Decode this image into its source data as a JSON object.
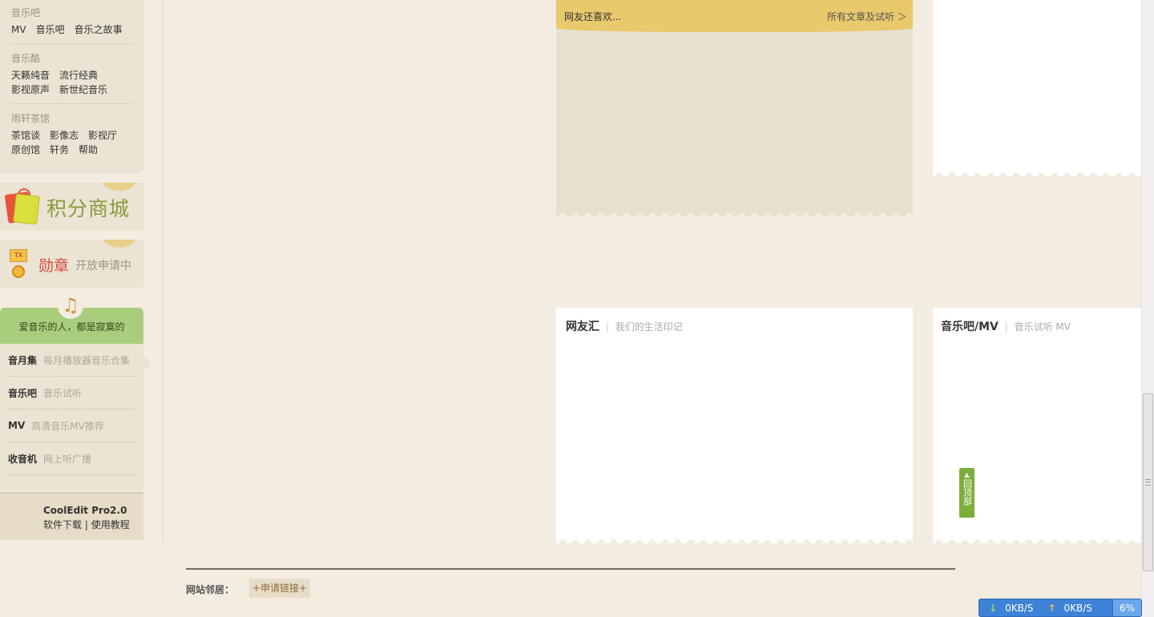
{
  "nav": {
    "groups": [
      {
        "head": "音乐吧",
        "lines": [
          [
            "MV",
            "音乐吧",
            "音乐之故事"
          ]
        ]
      },
      {
        "head": "音乐酷",
        "lines": [
          [
            "天籁纯音",
            "流行经典"
          ],
          [
            "影视原声",
            "新世纪音乐"
          ]
        ]
      },
      {
        "head": "雨轩茶馆",
        "lines": [
          [
            "茶馆谈",
            "影像志",
            "影视厅"
          ],
          [
            "原创馆",
            "轩务",
            "帮助"
          ]
        ]
      }
    ]
  },
  "promos": {
    "shop": "积分商城",
    "medal": "勋章",
    "medal_sub": "开放申请中",
    "medal_icon_text": "TX"
  },
  "music": {
    "slogan": "爱音乐的人，都是寂寞的",
    "note": "♫",
    "items": [
      {
        "title": "音月集",
        "desc": "每月播放器音乐合集"
      },
      {
        "title": "音乐吧",
        "desc": "音乐试听"
      },
      {
        "title": "MV",
        "desc": "高清音乐MV推荐"
      },
      {
        "title": "收音机",
        "desc": "网上听广播"
      }
    ],
    "cooledit_title": "CoolEdit Pro2.0",
    "cooledit_download": "软件下载",
    "cooledit_sep": "|",
    "cooledit_tutorial": "使用教程"
  },
  "cards": {
    "yellow_left": "网友还喜欢...",
    "yellow_right": "所有文章及试听 ＞",
    "netfriend_title": "网友汇",
    "netfriend_sub": "我们的生活印记",
    "musicbar_title": "音乐吧/MV",
    "musicbar_sub": "音乐试听 MV",
    "sep": "|"
  },
  "back_top": {
    "arrow": "▲",
    "label": "回顶部"
  },
  "footer": {
    "label": "网站邻居：",
    "apply_link": "+申请链接+"
  },
  "speed": {
    "down_arrow": "↓",
    "down": "0KB/S",
    "up_arrow": "↑",
    "up": "0KB/S",
    "percent": "6%"
  },
  "colors": {
    "page_bg": "#f3ece0",
    "panel_bg": "#ebe3d3",
    "yellow_header": "#e8c96c",
    "music_green": "#a8cd7c",
    "back_top_green": "#7cae3c",
    "speed_blue": "#3d82d6"
  }
}
